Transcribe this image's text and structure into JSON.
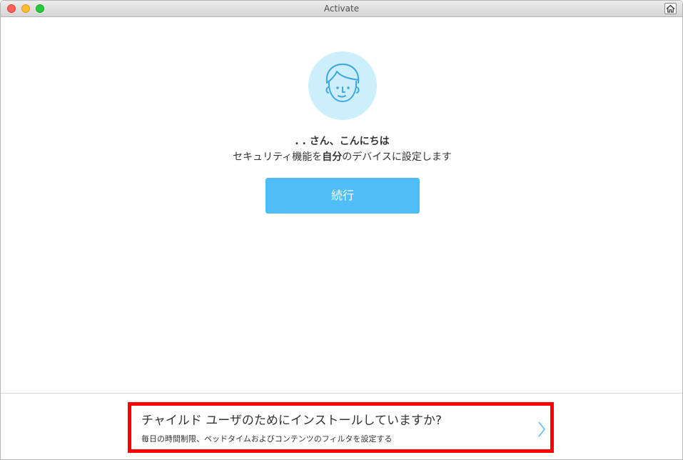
{
  "window": {
    "title": "Activate"
  },
  "main": {
    "greeting_prefix": ". . ",
    "greeting": "さん、こんにちは",
    "subtitle_before": "セキュリティ機能を",
    "subtitle_bold": "自分",
    "subtitle_after": "のデバイスに設定します",
    "continue_label": "続行"
  },
  "child_install": {
    "title": "チャイルド ユーザのためにインストールしていますか?",
    "description": "毎日の時間制限、ベッドタイムおよびコンテンツのフィルタを設定する"
  },
  "colors": {
    "accent": "#4fbdf8",
    "avatar_bg": "#cdeefc",
    "highlight_border": "#ff0000"
  },
  "icons": {
    "avatar": "user-face-icon",
    "home": "home-icon",
    "chevron": "chevron-right-icon"
  }
}
